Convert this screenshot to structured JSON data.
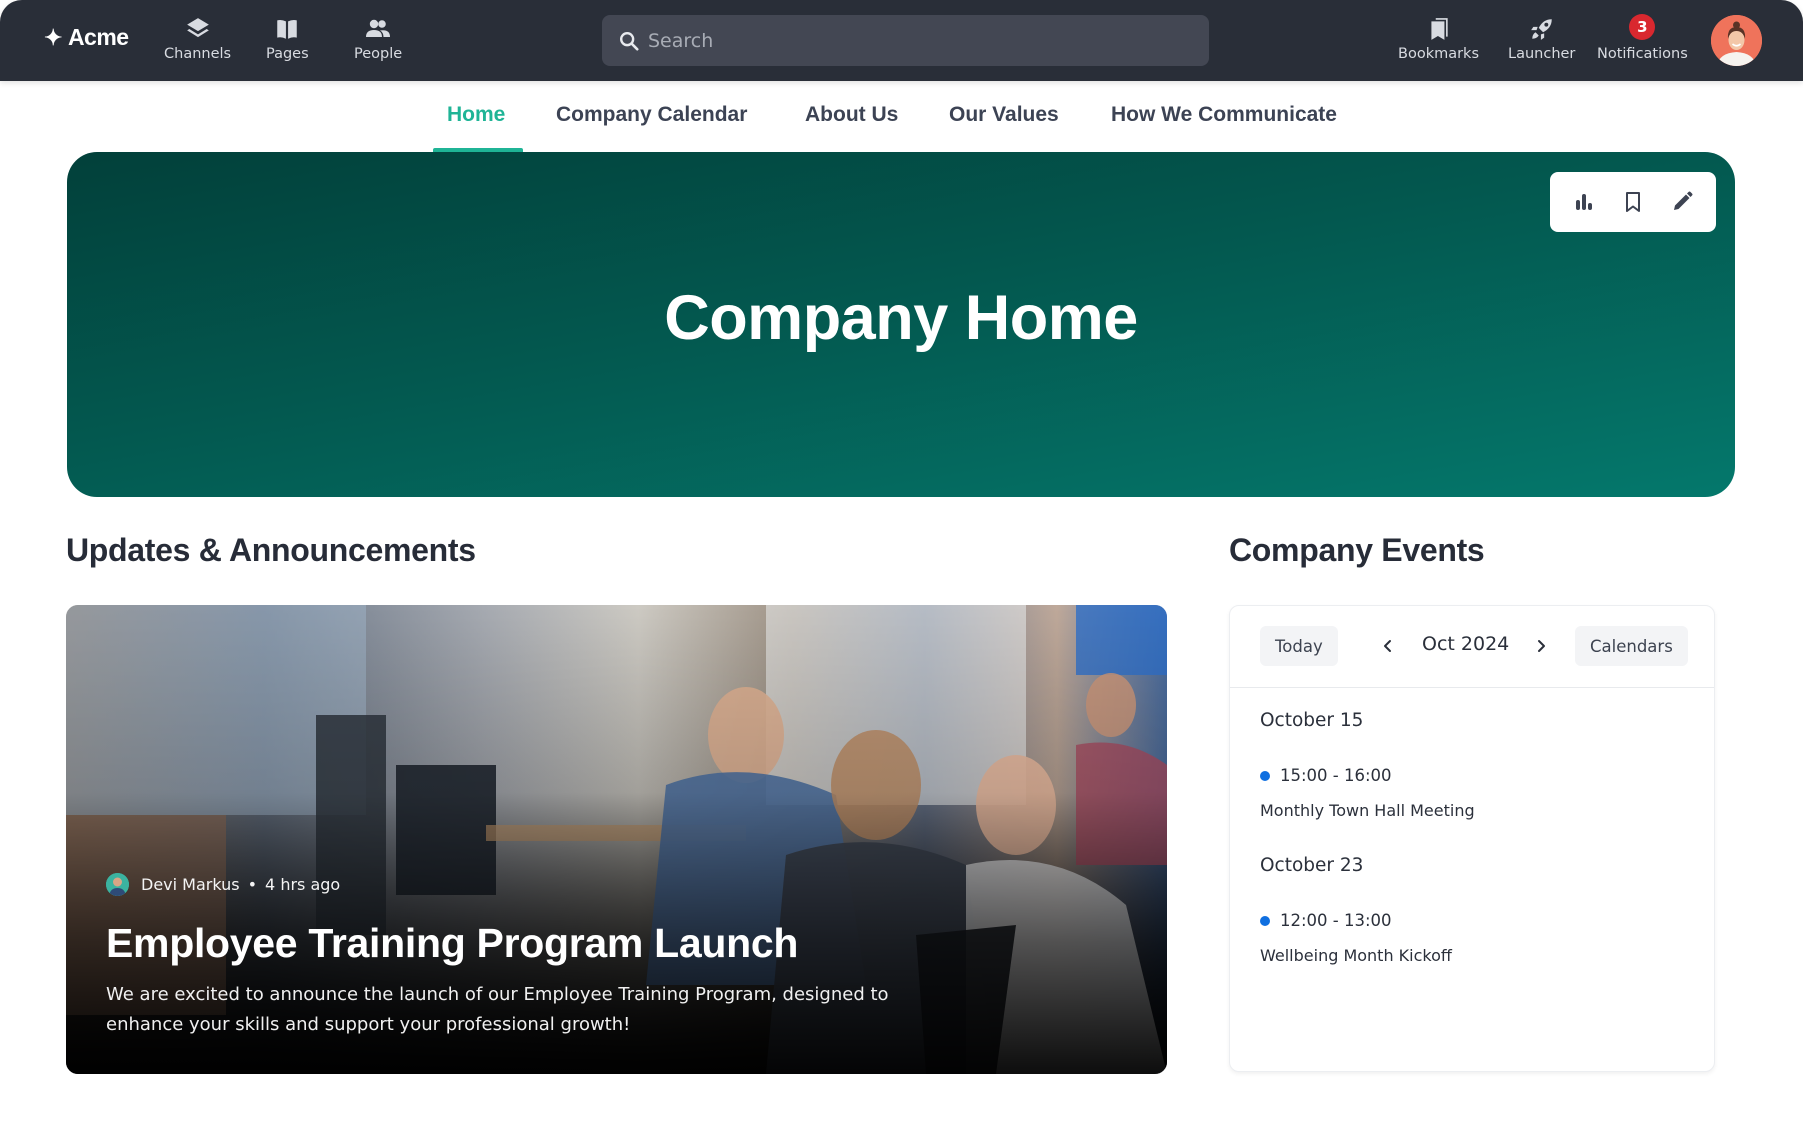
{
  "topbar": {
    "brand": "Acme",
    "brand_icon": "sparkle-icon",
    "nav_left": [
      {
        "label": "Channels",
        "icon": "layers-icon"
      },
      {
        "label": "Pages",
        "icon": "book-icon"
      },
      {
        "label": "People",
        "icon": "people-icon"
      }
    ],
    "search": {
      "placeholder": "Search",
      "value": ""
    },
    "nav_right": [
      {
        "label": "Bookmarks",
        "icon": "bookmarks-icon"
      },
      {
        "label": "Launcher",
        "icon": "rocket-icon"
      },
      {
        "label": "Notifications",
        "icon": "bell-icon",
        "badge": "3"
      }
    ],
    "avatar": "user-avatar"
  },
  "tabs": [
    {
      "label": "Home",
      "active": true
    },
    {
      "label": "Company Calendar",
      "active": false
    },
    {
      "label": "About Us",
      "active": false
    },
    {
      "label": "Our Values",
      "active": false
    },
    {
      "label": "How We Communicate",
      "active": false
    }
  ],
  "hero": {
    "title": "Company Home",
    "tools": [
      "analytics-icon",
      "bookmark-icon",
      "edit-icon"
    ]
  },
  "updates": {
    "heading": "Updates & Announcements",
    "post": {
      "author": "Devi Markus",
      "separator": "•",
      "time": "4 hrs ago",
      "title": "Employee Training Program Launch",
      "body": "We are excited to announce the launch of our Employee Training Program, designed to enhance your skills and support your professional growth!"
    }
  },
  "events": {
    "heading": "Company Events",
    "today_label": "Today",
    "month": "Oct 2024",
    "calendars_label": "Calendars",
    "days": [
      {
        "date": "October 15",
        "time": "15:00 - 16:00",
        "title": "Monthly Town Hall Meeting"
      },
      {
        "date": "October 23",
        "time": "12:00 - 13:00",
        "title": "Wellbeing Month Kickoff"
      }
    ]
  },
  "colors": {
    "accent": "#1fb496",
    "topbar": "#292e38",
    "hero_dark": "#02403a",
    "hero_light": "#04786c",
    "badge": "#d9282f",
    "event_dot": "#0f6fe0"
  }
}
